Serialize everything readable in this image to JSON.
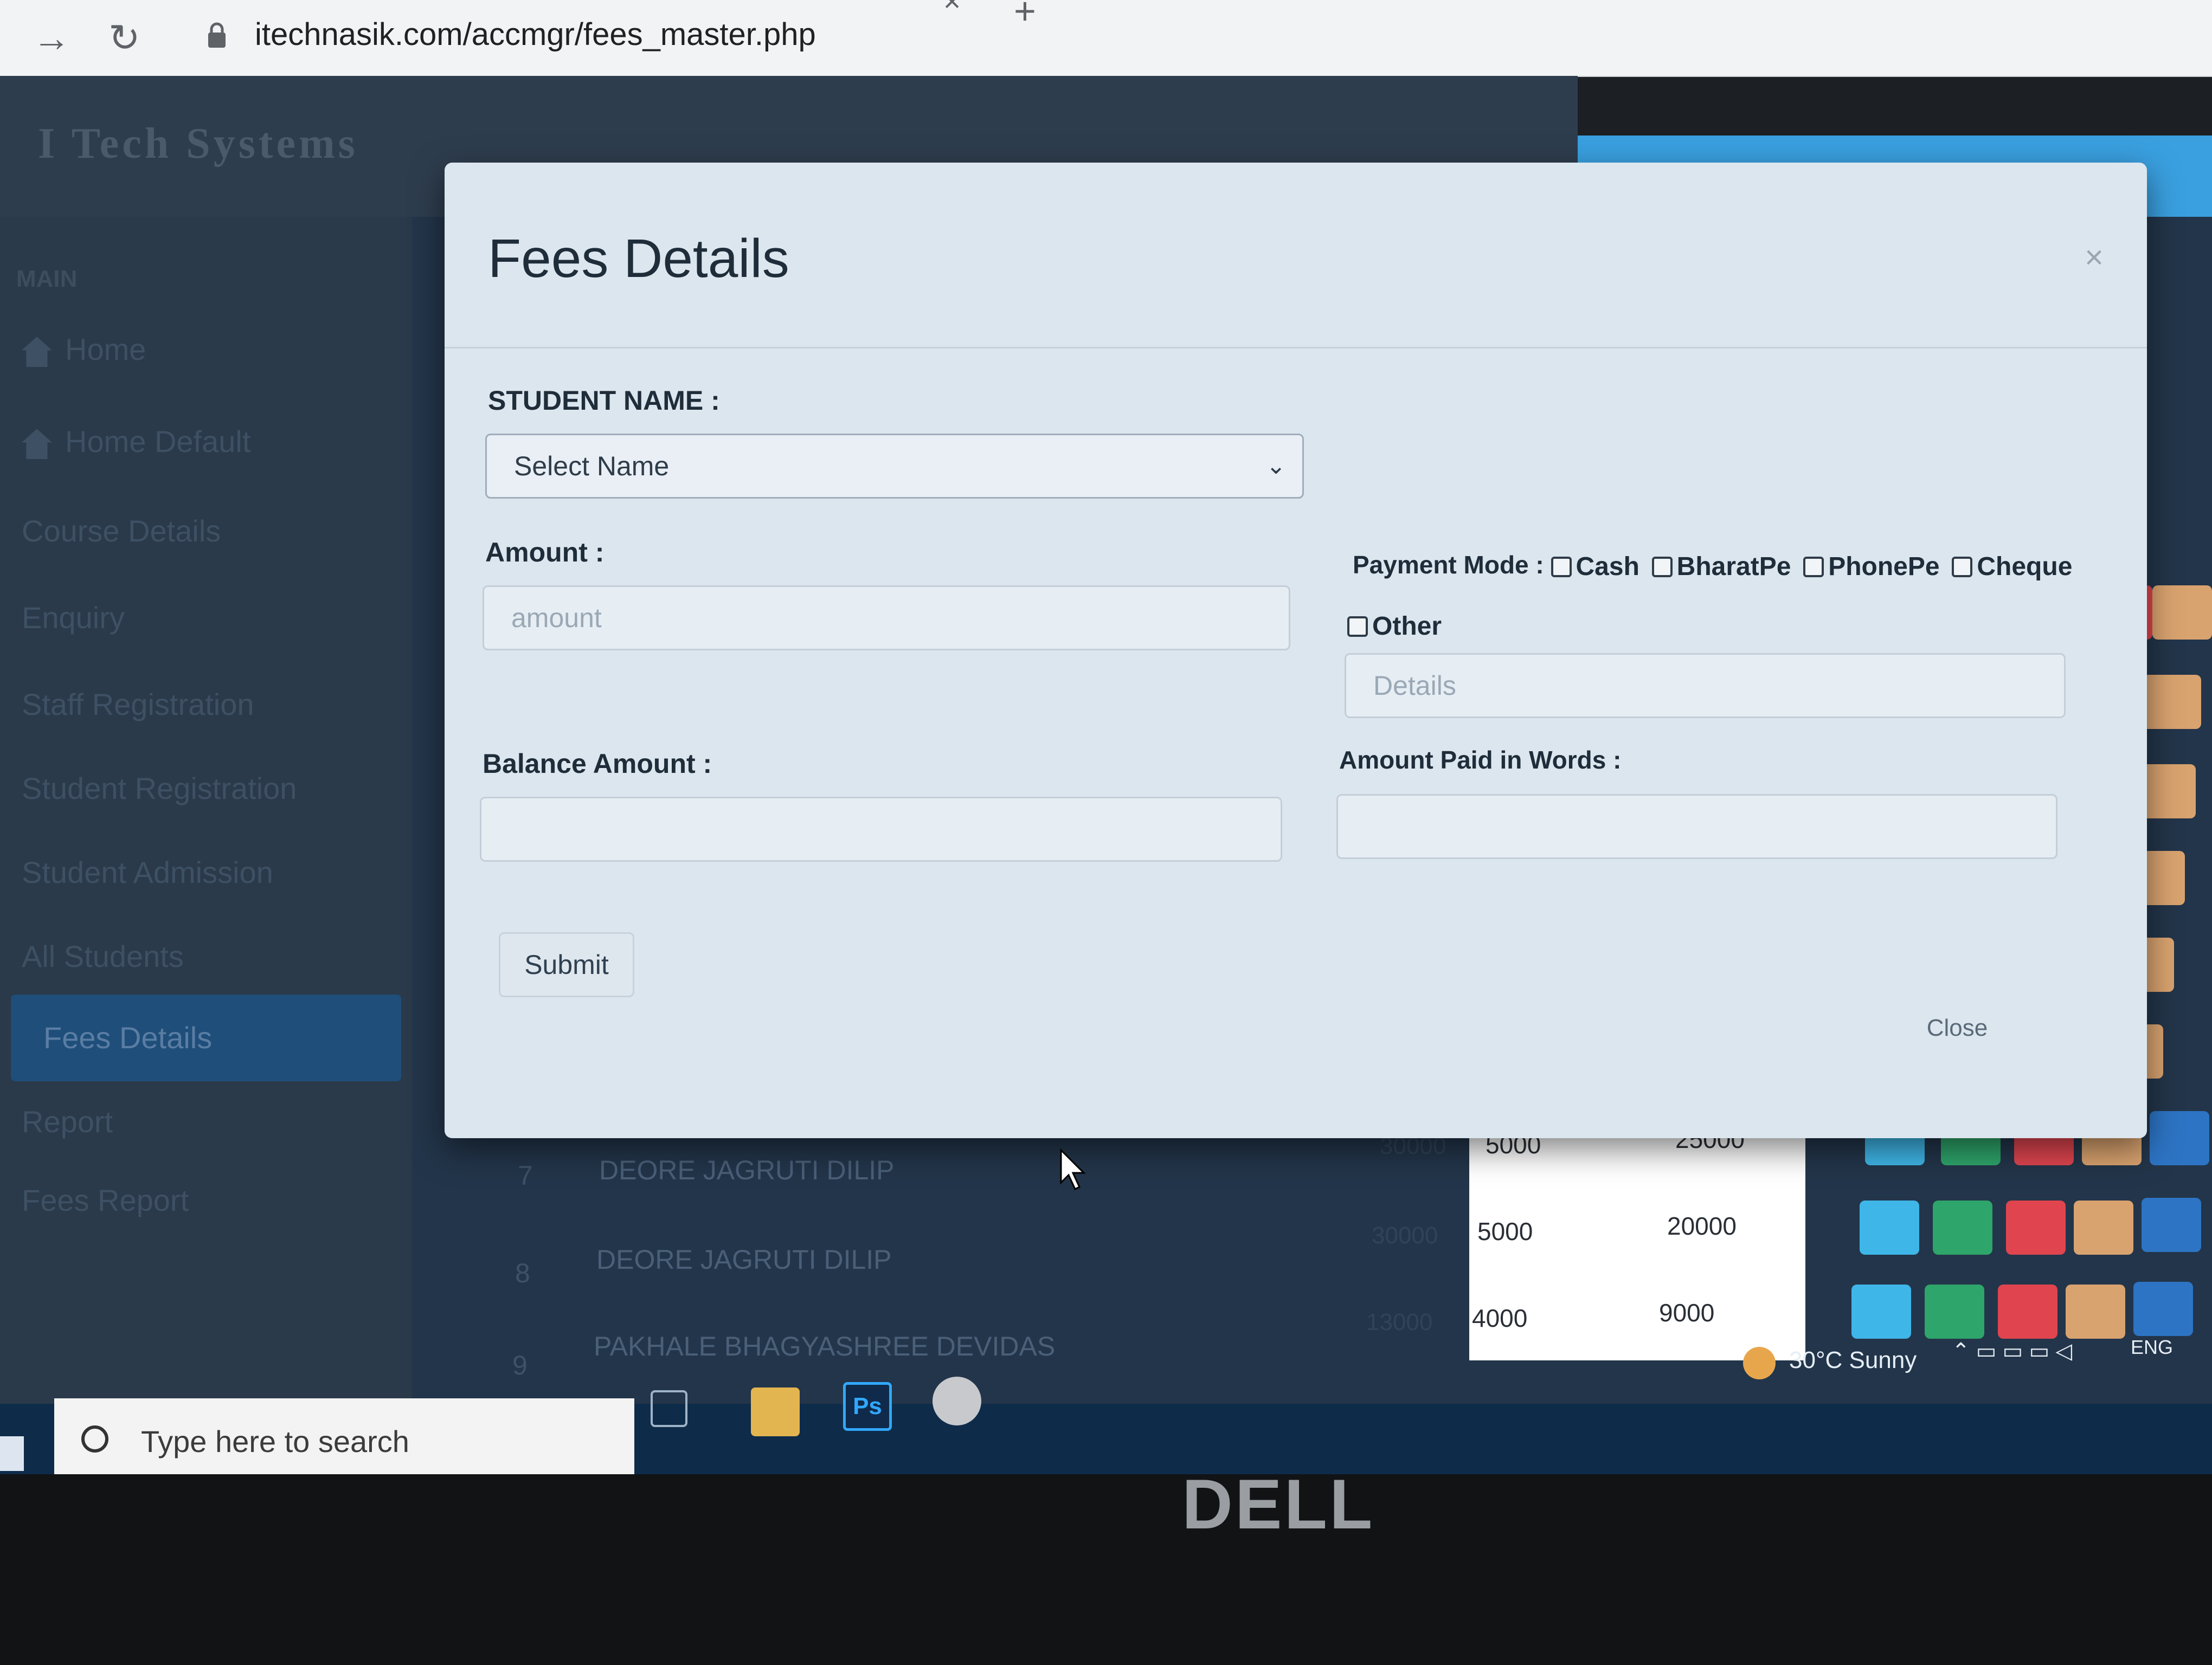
{
  "browser": {
    "url": "itechnasik.com/accmgr/fees_master.php",
    "back_icon": "back-arrow-icon",
    "reload_icon": "reload-icon",
    "new_tab": "+",
    "tab_close": "×"
  },
  "app": {
    "brand": "I Tech Systems",
    "sidebar": {
      "section": "MAIN",
      "items": [
        {
          "label": "Home"
        },
        {
          "label": "Home Default"
        },
        {
          "label": "Course Details"
        },
        {
          "label": "Enquiry"
        },
        {
          "label": "Staff Registration"
        },
        {
          "label": "Student Registration"
        },
        {
          "label": "Student Admission"
        },
        {
          "label": "All Students"
        },
        {
          "label": "Fees Details"
        },
        {
          "label": "Report"
        },
        {
          "label": "Fees Report"
        }
      ]
    },
    "table": {
      "rows": [
        {
          "num": "7",
          "name": "DEORE JAGRUTI DILIP",
          "total": "30000",
          "paid": "5000",
          "balance": "25000"
        },
        {
          "num": "8",
          "name": "DEORE JAGRUTI DILIP",
          "total": "30000",
          "paid": "5000",
          "balance": "20000"
        },
        {
          "num": "9",
          "name": "PAKHALE BHAGYASHREE DEVIDAS",
          "total": "13000",
          "paid": "4000",
          "balance": "9000"
        }
      ]
    }
  },
  "modal": {
    "title": "Fees Details",
    "close_x": "×",
    "student_name_label": "STUDENT NAME :",
    "student_name_selected": "Select Name",
    "amount_label": "Amount :",
    "amount_placeholder": "amount",
    "payment_mode_label": "Payment Mode :",
    "payment_modes": [
      "Cash",
      "BharatPe",
      "PhonePe",
      "Cheque",
      "Other"
    ],
    "details_placeholder": "Details",
    "balance_label": "Balance Amount :",
    "words_label": "Amount Paid in Words :",
    "submit": "Submit",
    "close": "Close"
  },
  "taskbar": {
    "search_placeholder": "Type here to search",
    "weather": "30°C  Sunny",
    "lang": "ENG"
  },
  "monitor": {
    "brand": "DELL"
  },
  "colors": {
    "modal_bg": "#dce6ee",
    "sidebar_active": "#1f4e7a",
    "header_accent": "#3aa0e0",
    "action_blue": "#3fb6e8",
    "action_green": "#2ea56a",
    "action_red": "#e0454f",
    "action_tan": "#d9a36f"
  }
}
